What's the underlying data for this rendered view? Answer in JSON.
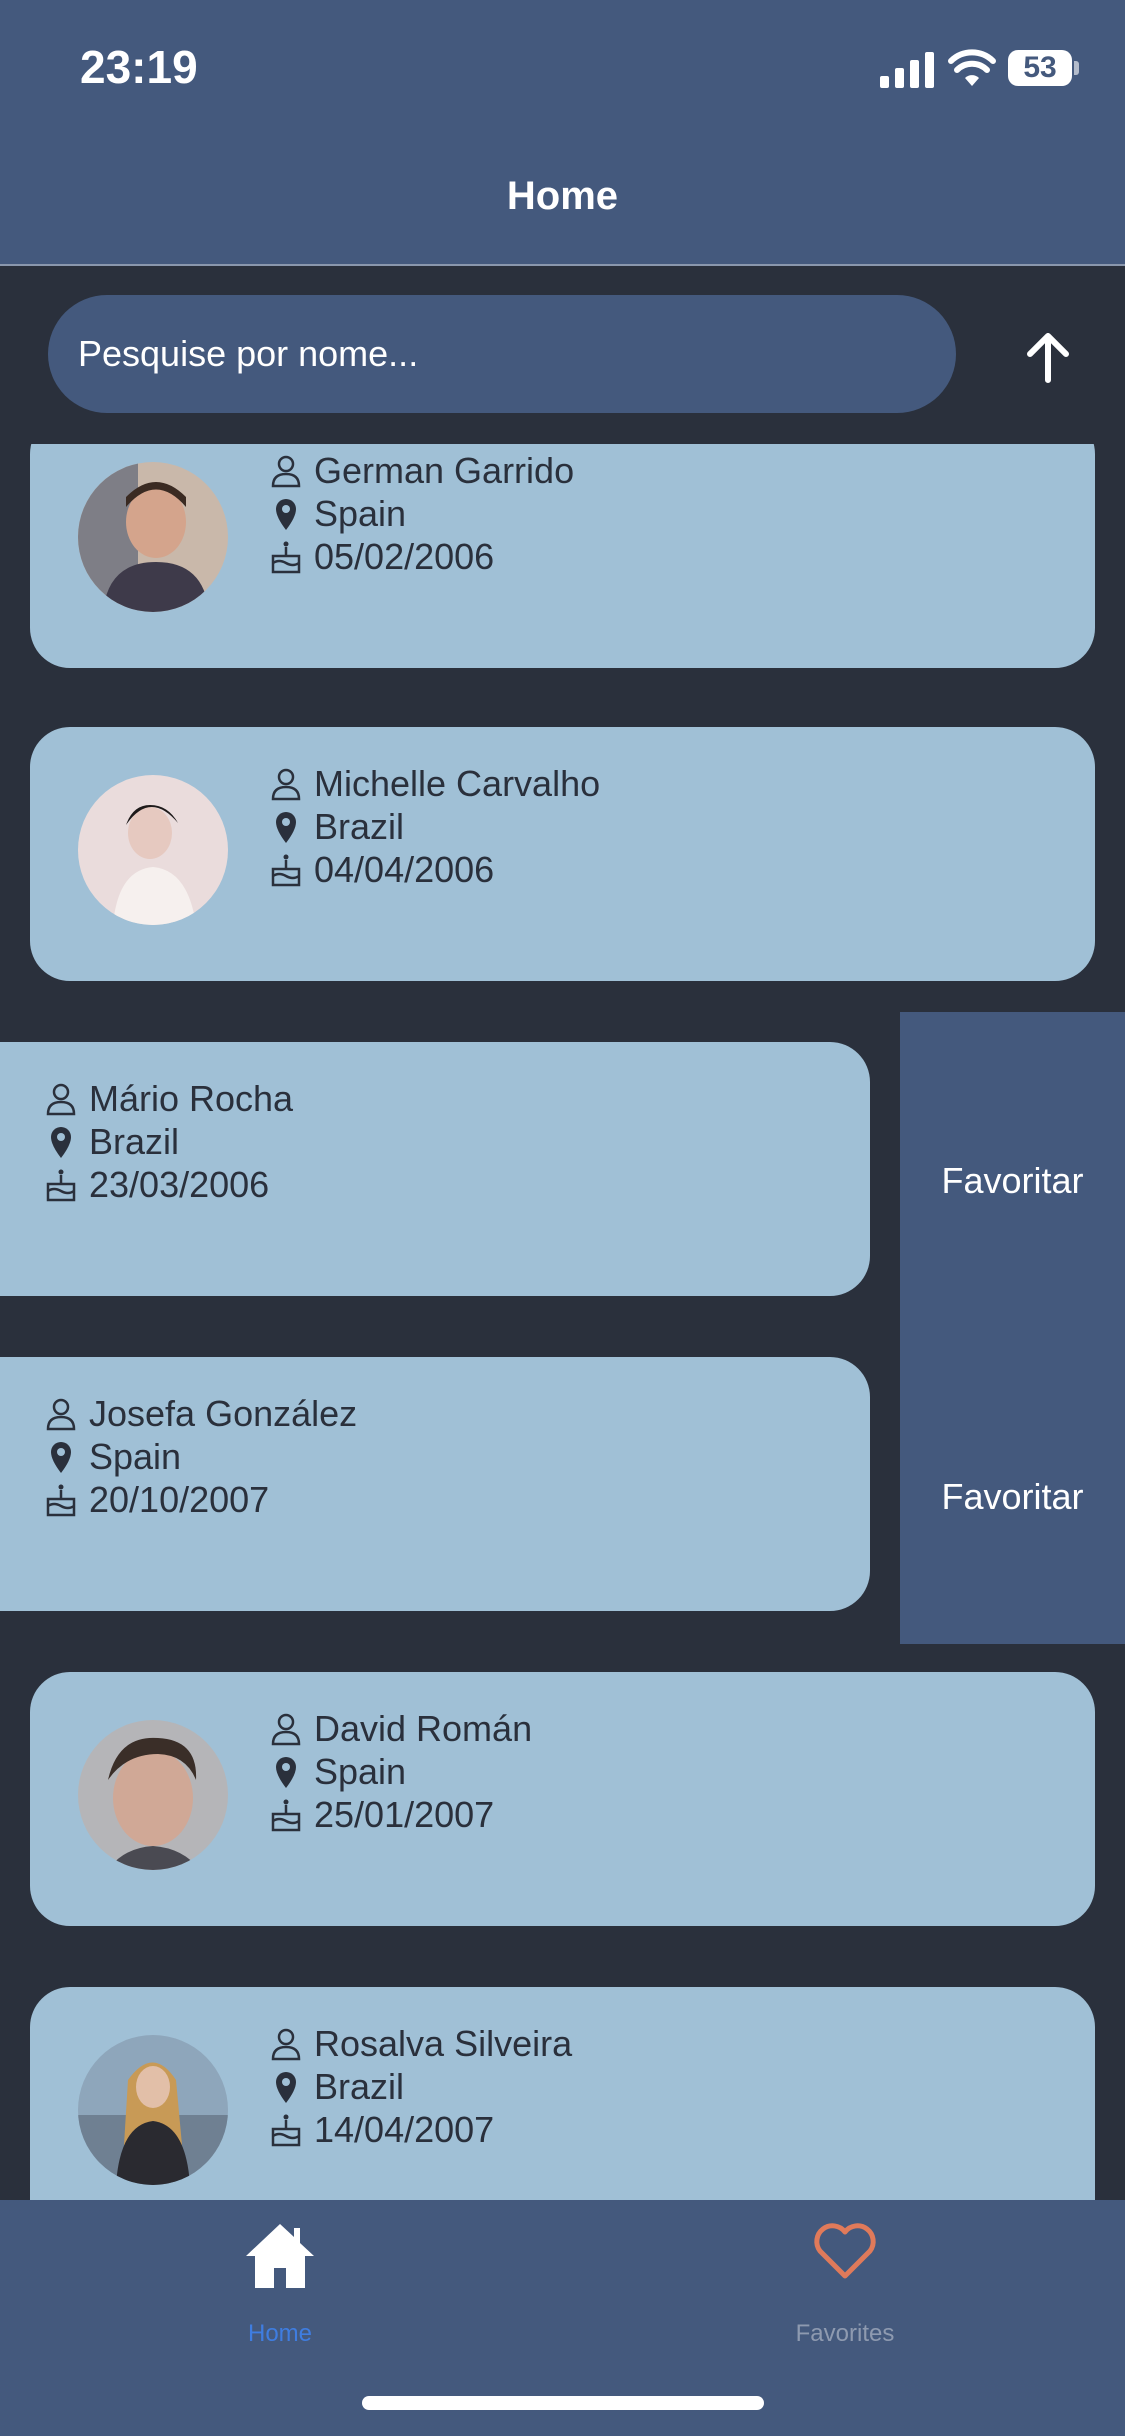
{
  "status_bar": {
    "time": "23:19",
    "battery": "53"
  },
  "app_bar": {
    "title": "Home"
  },
  "search": {
    "placeholder": "Pesquise por nome..."
  },
  "people": [
    {
      "name": "German Garrido",
      "country": "Spain",
      "birthdate": "05/02/2006"
    },
    {
      "name": "Michelle Carvalho",
      "country": "Brazil",
      "birthdate": "04/04/2006"
    },
    {
      "name": "Mário Rocha",
      "country": "Brazil",
      "birthdate": "23/03/2006"
    },
    {
      "name": "Josefa González",
      "country": "Spain",
      "birthdate": "20/10/2007"
    },
    {
      "name": "David Román",
      "country": "Spain",
      "birthdate": "25/01/2007"
    },
    {
      "name": "Rosalva Silveira",
      "country": "Brazil",
      "birthdate": "14/04/2007"
    }
  ],
  "swipe_actions": {
    "favorite_label": "Favoritar"
  },
  "bottom_nav": {
    "items": [
      {
        "label": "Home",
        "icon": "home-icon",
        "active": true
      },
      {
        "label": "Favorites",
        "icon": "heart-icon",
        "active": false
      }
    ]
  },
  "colors": {
    "background": "#2a303c",
    "bar": "#44597d",
    "card": "#a0c0d6",
    "active_tab": "#3f7de0",
    "heart": "#e07a5a"
  }
}
